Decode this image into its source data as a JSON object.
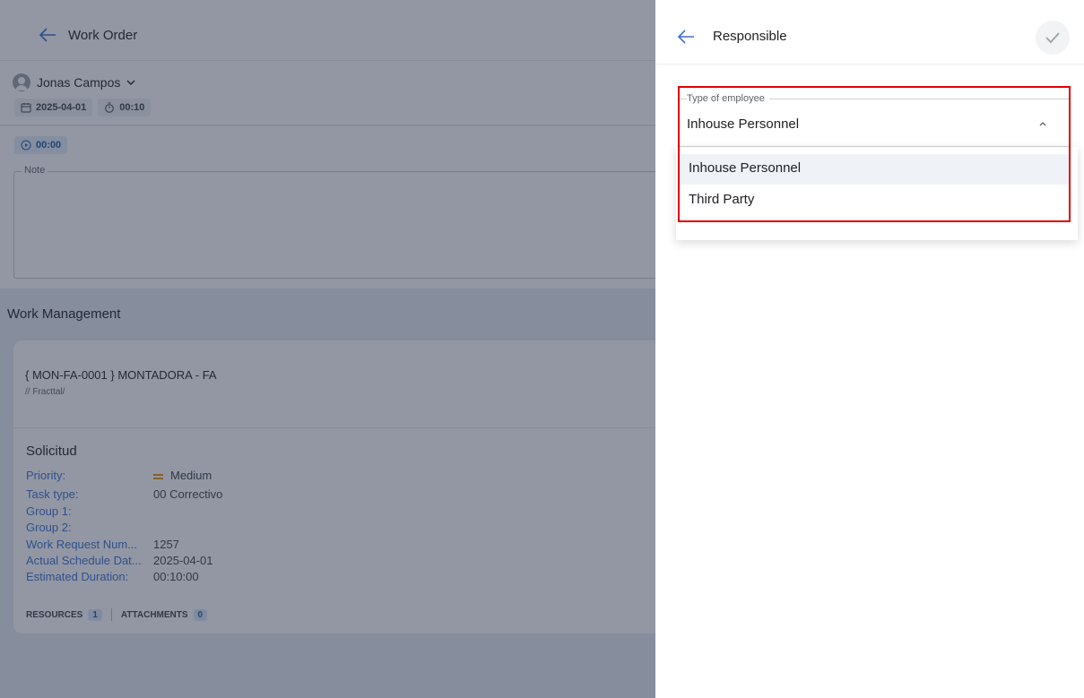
{
  "work_order": {
    "title": "Work Order",
    "user_name": "Jonas Campos",
    "date": "2025-04-01",
    "duration": "00:10",
    "timer": "00:00",
    "note_label": "Note",
    "work_management_title": "Work Management",
    "asset_title": "{ MON-FA-0001 } MONTADORA - FA",
    "asset_path": "// Fracttal/",
    "request_title": "Solicitud",
    "fields": [
      {
        "key": "Priority:",
        "value": "Medium"
      },
      {
        "key": "Task type:",
        "value": "00 Correctivo"
      },
      {
        "key": "Group 1:",
        "value": ""
      },
      {
        "key": "Group 2:",
        "value": ""
      },
      {
        "key": "Work Request Num...",
        "value": "1257"
      },
      {
        "key": "Actual Schedule Dat...",
        "value": "2025-04-01"
      },
      {
        "key": "Estimated Duration:",
        "value": "00:10:00"
      }
    ],
    "resources_label": "RESOURCES",
    "resources_count": "1",
    "attachments_label": "ATTACHMENTS",
    "attachments_count": "0"
  },
  "panel": {
    "title": "Responsible",
    "field_label": "Type of employee",
    "field_value": "Inhouse Personnel",
    "options": [
      {
        "label": "Inhouse Personnel",
        "selected": true
      },
      {
        "label": "Third Party",
        "selected": false
      }
    ]
  },
  "colors": {
    "accent": "#3b6fd4",
    "highlight_border": "#e00000",
    "priority_medium": "#e8910b"
  }
}
